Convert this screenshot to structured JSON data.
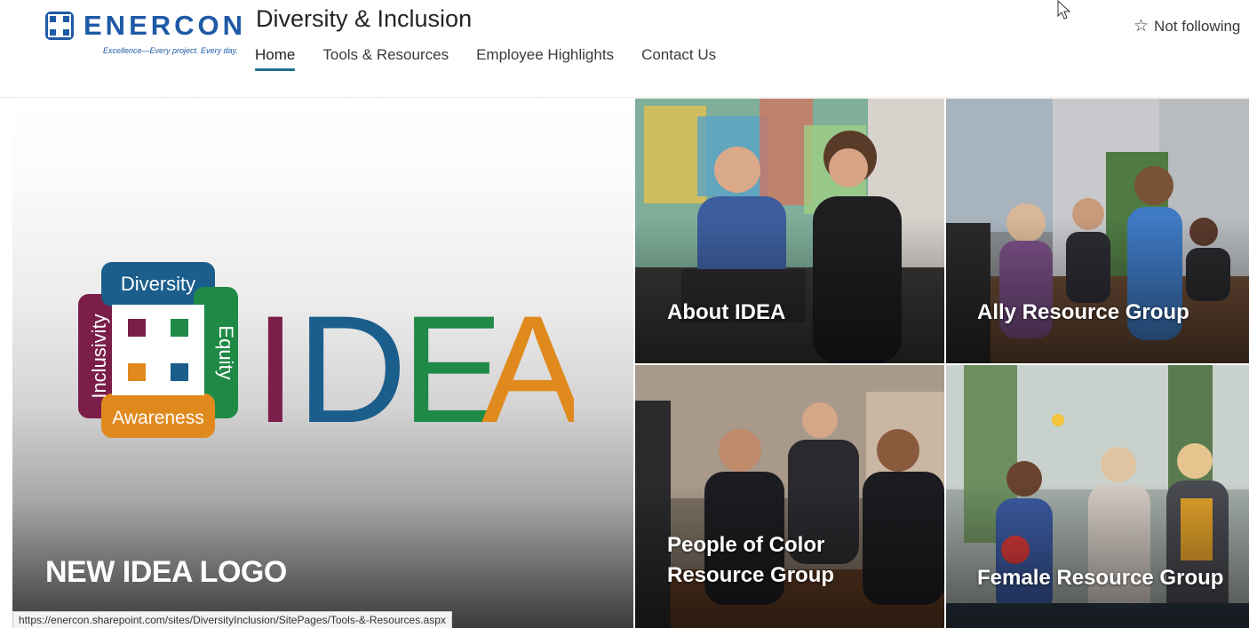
{
  "brand": {
    "name": "ENERCON",
    "tagline": "Excellence—Every project. Every day.",
    "color": "#1f5aa6"
  },
  "site": {
    "title": "Diversity & Inclusion"
  },
  "nav": {
    "items": [
      {
        "label": "Home",
        "active": true
      },
      {
        "label": "Tools & Resources",
        "active": false
      },
      {
        "label": "Employee Highlights",
        "active": false
      },
      {
        "label": "Contact Us",
        "active": false
      }
    ]
  },
  "follow": {
    "icon": "star-outline-icon",
    "label": "Not following"
  },
  "hero": {
    "main": {
      "title": "NEW IDEA LOGO",
      "logo": {
        "wordmark": "IDEA",
        "words": [
          "Diversity",
          "Equity",
          "Awareness",
          "Inclusivity"
        ],
        "colors": {
          "I": "#7b1f4a",
          "D": "#1b5e8c",
          "E": "#1e8a46",
          "A": "#e08a1e"
        }
      }
    },
    "tiles": [
      {
        "title": "About IDEA"
      },
      {
        "title": "Ally Resource Group"
      },
      {
        "title": "People of Color Resource Group"
      },
      {
        "title": "Female Resource Group"
      }
    ]
  },
  "statusbar": {
    "url": "https://enercon.sharepoint.com/sites/DiversityInclusion/SitePages/Tools-&-Resources.aspx"
  }
}
